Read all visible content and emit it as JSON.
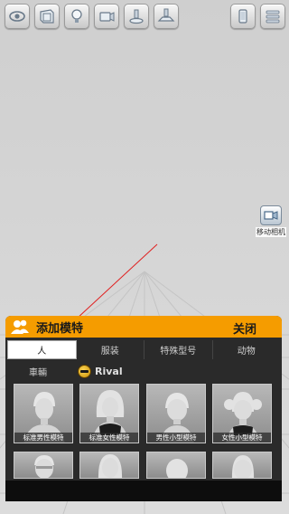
{
  "toolbar": {
    "buttons": [
      {
        "id": "visibility",
        "icon": "eye-icon"
      },
      {
        "id": "background",
        "icon": "picture-frame-icon"
      },
      {
        "id": "light",
        "icon": "light-bulb-icon"
      },
      {
        "id": "camera",
        "icon": "camera-icon"
      },
      {
        "id": "model-stand",
        "icon": "stand-icon"
      },
      {
        "id": "floor",
        "icon": "pedestal-icon"
      },
      {
        "id": "device",
        "icon": "phone-icon"
      },
      {
        "id": "menu",
        "icon": "menu-icon"
      }
    ]
  },
  "move_camera": {
    "label": "移动相机",
    "icon": "move-camera-icon"
  },
  "panel": {
    "title": "添加模特",
    "close_label": "关闭",
    "accent": "#f59c00",
    "tabs": [
      "人",
      "服装",
      "特殊型号",
      "动物"
    ],
    "active_tab": "人",
    "subcategories": [
      "車輛",
      "Rival"
    ],
    "cards": [
      {
        "caption": "标准男性模特",
        "type": "male"
      },
      {
        "caption": "标准女性模特",
        "type": "female"
      },
      {
        "caption": "男性小型模特",
        "type": "male-child"
      },
      {
        "caption": "女性小型模特",
        "type": "female-child"
      },
      {
        "caption": "",
        "type": "male-old"
      },
      {
        "caption": "",
        "type": "female-older"
      },
      {
        "caption": "",
        "type": "baby"
      },
      {
        "caption": "",
        "type": "girl-alt"
      }
    ]
  }
}
